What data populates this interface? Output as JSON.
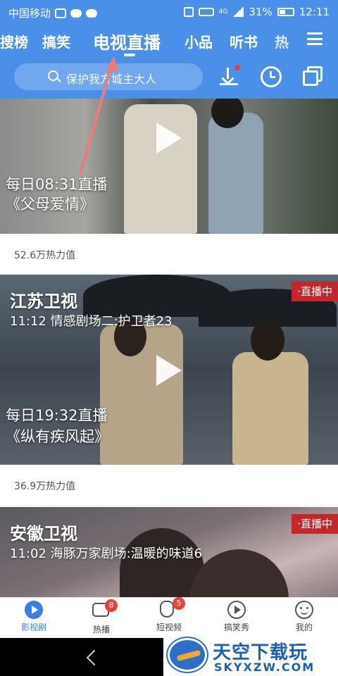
{
  "status_bar": {
    "carrier": "中国移动",
    "network": "4G",
    "battery": "31%",
    "time": "12:11"
  },
  "top_tabs": [
    "搜榜",
    "搞笑",
    "电视直播",
    "小品",
    "听书",
    "热"
  ],
  "active_tab": "电视直播",
  "search": {
    "placeholder": "保护我方城主大人"
  },
  "colors": {
    "header": "#4a8fe8",
    "accent": "#3a7de3",
    "live_badge": "#c1272d"
  },
  "cards": [
    {
      "channel": "",
      "program": "",
      "live_label": "",
      "daily": "每日08:31直播",
      "show": "《父母爱情》",
      "heat": "52.6万热力值"
    },
    {
      "channel": "江苏卫视",
      "program": "11:12 情感剧场二:护卫者23",
      "live_label": "·直播中",
      "daily": "每日19:32直播",
      "show": "《纵有疾风起》",
      "heat": "36.9万热力值"
    },
    {
      "channel": "安徽卫视",
      "program": "11:02 海豚万家剧场:温暖的味道6",
      "live_label": "·直播中"
    }
  ],
  "bottom_nav": [
    {
      "label": "影视剧",
      "icon": "video-play-icon",
      "badge": ""
    },
    {
      "label": "热播",
      "icon": "camera-icon",
      "badge": "8"
    },
    {
      "label": "短视频",
      "icon": "hand-icon",
      "badge": "5"
    },
    {
      "label": "搞笑秀",
      "icon": "play-circle-icon",
      "badge": ""
    },
    {
      "label": "我的",
      "icon": "smile-icon",
      "badge": ""
    }
  ],
  "watermark": {
    "title": "天空下载玩",
    "url": "SKYXZW.COM"
  }
}
